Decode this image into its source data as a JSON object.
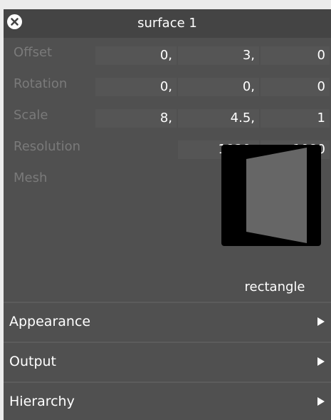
{
  "window": {
    "title": "surface 1"
  },
  "properties": {
    "offset": {
      "label": "Offset",
      "values": [
        "0,",
        "3,",
        "0"
      ]
    },
    "rotation": {
      "label": "Rotation",
      "values": [
        "0,",
        "0,",
        "0"
      ]
    },
    "scale": {
      "label": "Scale",
      "values": [
        "8,",
        "4.5,",
        "1"
      ]
    },
    "resolution": {
      "label": "Resolution",
      "values": [
        "1920,",
        "1080"
      ]
    },
    "mesh": {
      "label": "Mesh",
      "value": "rectangle"
    }
  },
  "sections": [
    {
      "label": "Appearance",
      "icon": "chevron-right-icon"
    },
    {
      "label": "Output",
      "icon": "chevron-right-icon"
    },
    {
      "label": "Hierarchy",
      "icon": "chevron-right-icon"
    }
  ],
  "colors": {
    "background": "#ececec",
    "panel": "#505050",
    "titlebar": "#444444",
    "field": "#555555",
    "label": "#7a7a7a",
    "text": "#ffffff"
  }
}
